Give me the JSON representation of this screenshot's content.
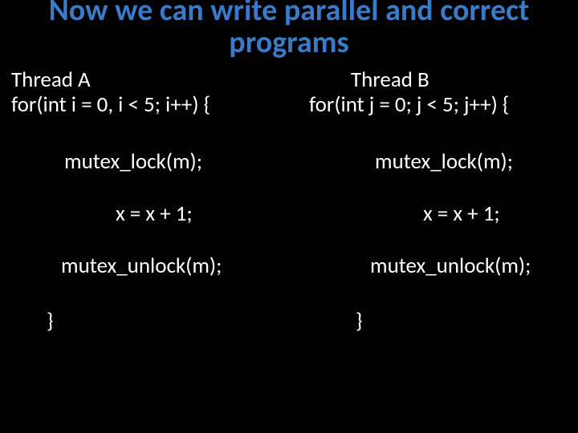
{
  "title": "Now we can write parallel and correct programs",
  "threadA": {
    "header": "Thread A",
    "for": "for(int i = 0, i < 5; i++) {",
    "lock": "mutex_lock(m);",
    "inc": "x = x + 1;",
    "unlock": "mutex_unlock(m);",
    "close": "}"
  },
  "threadB": {
    "header": "Thread B",
    "for": "for(int j = 0; j < 5; j++) {",
    "lock": "mutex_lock(m);",
    "inc": "x = x + 1;",
    "unlock": "mutex_unlock(m);",
    "close": "}"
  }
}
